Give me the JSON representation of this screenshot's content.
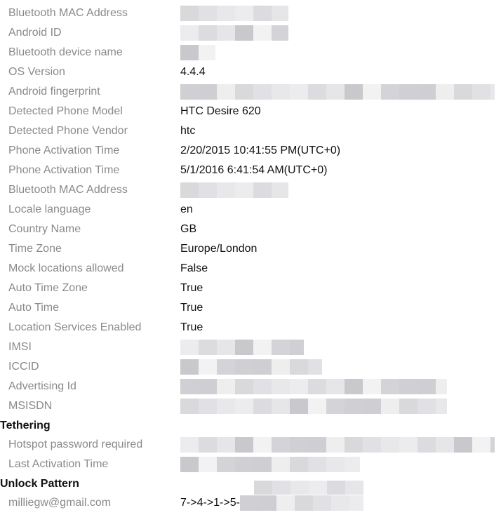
{
  "rows": [
    {
      "label": "Bluetooth MAC Address",
      "value": ""
    },
    {
      "label": "Android ID",
      "value": ""
    },
    {
      "label": "Bluetooth device name",
      "value": ""
    },
    {
      "label": "OS Version",
      "value": "4.4.4"
    },
    {
      "label": "Android fingerprint",
      "value": ""
    },
    {
      "label": "Detected Phone Model",
      "value": "HTC Desire 620"
    },
    {
      "label": "Detected Phone Vendor",
      "value": "htc"
    },
    {
      "label": "Phone Activation Time",
      "value": "2/20/2015 10:41:55 PM(UTC+0)"
    },
    {
      "label": "Phone Activation Time",
      "value": "5/1/2016 6:41:54 AM(UTC+0)"
    },
    {
      "label": "Bluetooth MAC Address",
      "value": ""
    },
    {
      "label": "Locale language",
      "value": "en"
    },
    {
      "label": "Country Name",
      "value": "GB"
    },
    {
      "label": "Time Zone",
      "value": "Europe/London"
    },
    {
      "label": "Mock locations allowed",
      "value": "False"
    },
    {
      "label": "Auto Time Zone",
      "value": "True"
    },
    {
      "label": "Auto Time",
      "value": "True"
    },
    {
      "label": "Location Services Enabled",
      "value": "True"
    },
    {
      "label": "IMSI",
      "value": ""
    },
    {
      "label": "ICCID",
      "value": ""
    },
    {
      "label": "Advertising Id",
      "value": ""
    },
    {
      "label": "MSISDN",
      "value": ""
    }
  ],
  "tethering": {
    "heading": "Tethering",
    "rows": [
      {
        "label": "Hotspot password required",
        "value": ""
      },
      {
        "label": "Last Activation Time",
        "value": ""
      }
    ]
  },
  "unlock": {
    "heading": "Unlock Pattern",
    "rows": [
      {
        "label": "milliegw@gmail.com",
        "value": "7->4->1->5-"
      }
    ]
  }
}
